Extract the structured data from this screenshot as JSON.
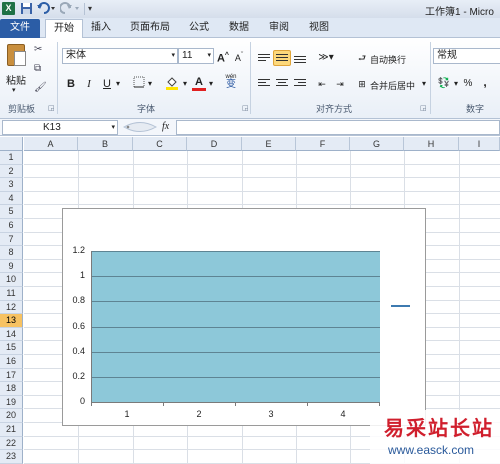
{
  "window": {
    "title": "工作簿1 - Micro"
  },
  "tabs": [
    "文件",
    "开始",
    "插入",
    "页面布局",
    "公式",
    "数据",
    "审阅",
    "视图"
  ],
  "ribbon": {
    "clipboard": {
      "paste_label": "粘贴",
      "group_label": "剪贴板"
    },
    "font": {
      "name": "宋体",
      "size": "11",
      "group_label": "字体",
      "bold": "B",
      "italic": "I",
      "underline": "U",
      "grow": "A",
      "shrink": "A",
      "font_color_letter": "A",
      "phonetic": "wén"
    },
    "alignment": {
      "wrap_text": "自动换行",
      "merge_center": "合并后居中",
      "group_label": "对齐方式"
    },
    "number": {
      "format": "常规",
      "group_label": "数字",
      "percent": "%",
      "comma": ","
    }
  },
  "formula_bar": {
    "name_box": "K13",
    "fx": "fx",
    "value": ""
  },
  "columns": [
    "A",
    "B",
    "C",
    "D",
    "E",
    "F",
    "G",
    "H",
    "I"
  ],
  "rows": [
    "1",
    "2",
    "3",
    "4",
    "5",
    "6",
    "7",
    "8",
    "9",
    "10",
    "11",
    "12",
    "13",
    "14",
    "15",
    "16",
    "17",
    "18",
    "19",
    "20",
    "21",
    "22",
    "23"
  ],
  "selected_row": "13",
  "colors": {
    "plot_fill": "#8dc8d9",
    "legend_line": "#3d7ab0",
    "ribbon_accent": "#2b5da6",
    "selected_header": "#f7c262"
  },
  "chart_data": {
    "type": "bar",
    "categories": [
      "1",
      "2",
      "3",
      "4"
    ],
    "ylim": [
      0,
      1.2
    ],
    "yticks": [
      "0",
      "0.2",
      "0.4",
      "0.6",
      "0.8",
      "1",
      "1.2"
    ],
    "grid": true,
    "legend": "right",
    "series": [
      {
        "values": [
          1.2,
          1.2,
          1.2,
          1.2
        ]
      }
    ]
  },
  "watermark": {
    "title": "易采站长站",
    "url": "www.easck.com"
  }
}
